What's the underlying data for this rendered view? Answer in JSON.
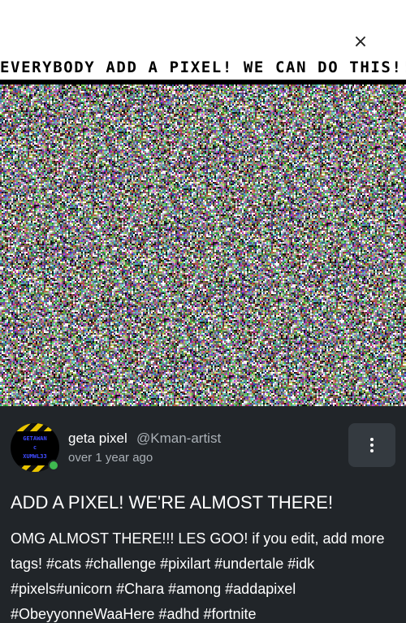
{
  "header": {
    "close_symbol": "×"
  },
  "banner": {
    "text": "EVERYBODY ADD A PIXEL! WE CAN DO THIS!!!"
  },
  "author": {
    "name": "geta pixel",
    "handle": "@Kman-artist",
    "posted": "over 1 year ago",
    "online": true,
    "avatar_line1": "GETAWAN",
    "avatar_line2": "c",
    "avatar_line3": "XUMWL33"
  },
  "post": {
    "title": "ADD A PIXEL! WE'RE ALMOST THERE!",
    "body": "OMG ALMOST THERE!!! LES GOO! if you edit, add more tags! #cats #challenge #pixilart #undertale #idk #pixels#unicorn #Chara #among #addapixel #ObeyyonneWaaHere #adhd #fortnite"
  },
  "menu": {
    "icon": "more-vertical-icon"
  },
  "colors": {
    "panel_bg": "#212529",
    "menu_bg": "#343a40",
    "online": "#3fb950",
    "muted_text": "#aab0b6"
  }
}
